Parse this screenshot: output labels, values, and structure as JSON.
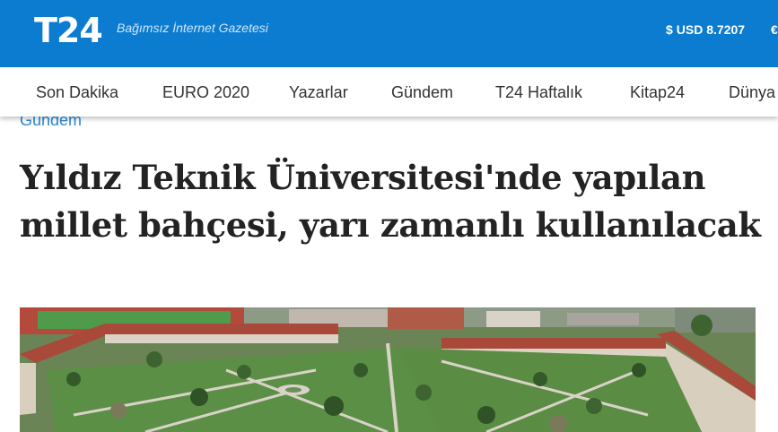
{
  "header": {
    "logo": "T24",
    "tagline": "Bağımsız İnternet Gazetesi",
    "currency_symbol": "$",
    "currency": "USD 8.7207",
    "currency_next_symbol": "€"
  },
  "nav": {
    "items": [
      {
        "label": "Son Dakika"
      },
      {
        "label": "EURO 2020"
      },
      {
        "label": "Yazarlar"
      },
      {
        "label": "Gündem"
      },
      {
        "label": "T24 Haftalık"
      },
      {
        "label": "Kitap24"
      },
      {
        "label": "Dünya"
      }
    ]
  },
  "article": {
    "category": "Gündem",
    "title": "Yıldız Teknik Üniversitesi'nde yapılan millet bahçesi, yarı zamanlı kullanılacak"
  },
  "colors": {
    "brand_blue": "#0b7cd0",
    "category_blue": "#2b8ad6",
    "headline": "#232323"
  }
}
